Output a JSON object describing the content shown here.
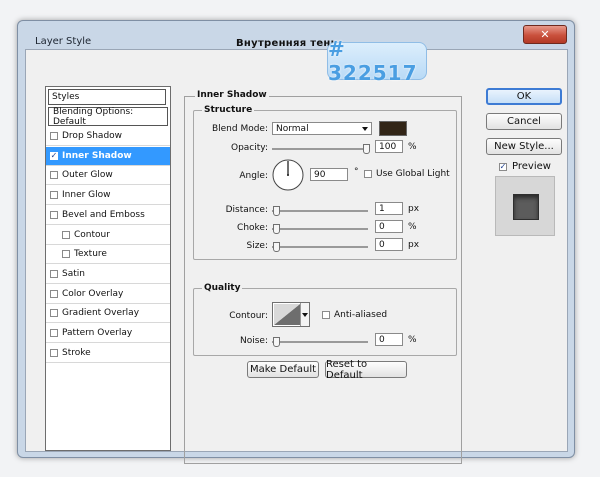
{
  "window": {
    "title": "Layer Style",
    "subtitle": "Внутренняя тень",
    "close_glyph": "✕"
  },
  "annotation": {
    "hex": "# 322517"
  },
  "styles_panel": {
    "header": "Styles",
    "blending": "Blending Options: Default",
    "items": [
      {
        "label": "Drop Shadow",
        "checked": false,
        "sub": false,
        "selected": false
      },
      {
        "label": "Inner Shadow",
        "checked": true,
        "sub": false,
        "selected": true
      },
      {
        "label": "Outer Glow",
        "checked": false,
        "sub": false,
        "selected": false
      },
      {
        "label": "Inner Glow",
        "checked": false,
        "sub": false,
        "selected": false
      },
      {
        "label": "Bevel and Emboss",
        "checked": false,
        "sub": false,
        "selected": false
      },
      {
        "label": "Contour",
        "checked": false,
        "sub": true,
        "selected": false
      },
      {
        "label": "Texture",
        "checked": false,
        "sub": true,
        "selected": false
      },
      {
        "label": "Satin",
        "checked": false,
        "sub": false,
        "selected": false
      },
      {
        "label": "Color Overlay",
        "checked": false,
        "sub": false,
        "selected": false
      },
      {
        "label": "Gradient Overlay",
        "checked": false,
        "sub": false,
        "selected": false
      },
      {
        "label": "Pattern Overlay",
        "checked": false,
        "sub": false,
        "selected": false
      },
      {
        "label": "Stroke",
        "checked": false,
        "sub": false,
        "selected": false
      }
    ]
  },
  "inner_shadow": {
    "section_title": "Inner Shadow",
    "structure": {
      "title": "Structure",
      "blend_mode_label": "Blend Mode:",
      "blend_mode_value": "Normal",
      "shadow_color": "#322517",
      "opacity_label": "Opacity:",
      "opacity_value": "100",
      "opacity_unit": "%",
      "opacity_fraction": 1.0,
      "angle_label": "Angle:",
      "angle_value": "90",
      "angle_unit": "°",
      "use_global_light_label": "Use Global Light",
      "use_global_light_checked": false,
      "distance_label": "Distance:",
      "distance_value": "1",
      "distance_unit": "px",
      "choke_label": "Choke:",
      "choke_value": "0",
      "choke_unit": "%",
      "size_label": "Size:",
      "size_value": "0",
      "size_unit": "px"
    },
    "quality": {
      "title": "Quality",
      "contour_label": "Contour:",
      "anti_aliased_label": "Anti-aliased",
      "anti_aliased_checked": false,
      "noise_label": "Noise:",
      "noise_value": "0",
      "noise_unit": "%"
    },
    "make_default_label": "Make Default",
    "reset_default_label": "Reset to Default"
  },
  "buttons": {
    "ok": "OK",
    "cancel": "Cancel",
    "new_style": "New Style..."
  },
  "preview": {
    "label": "Preview",
    "checked": true
  }
}
